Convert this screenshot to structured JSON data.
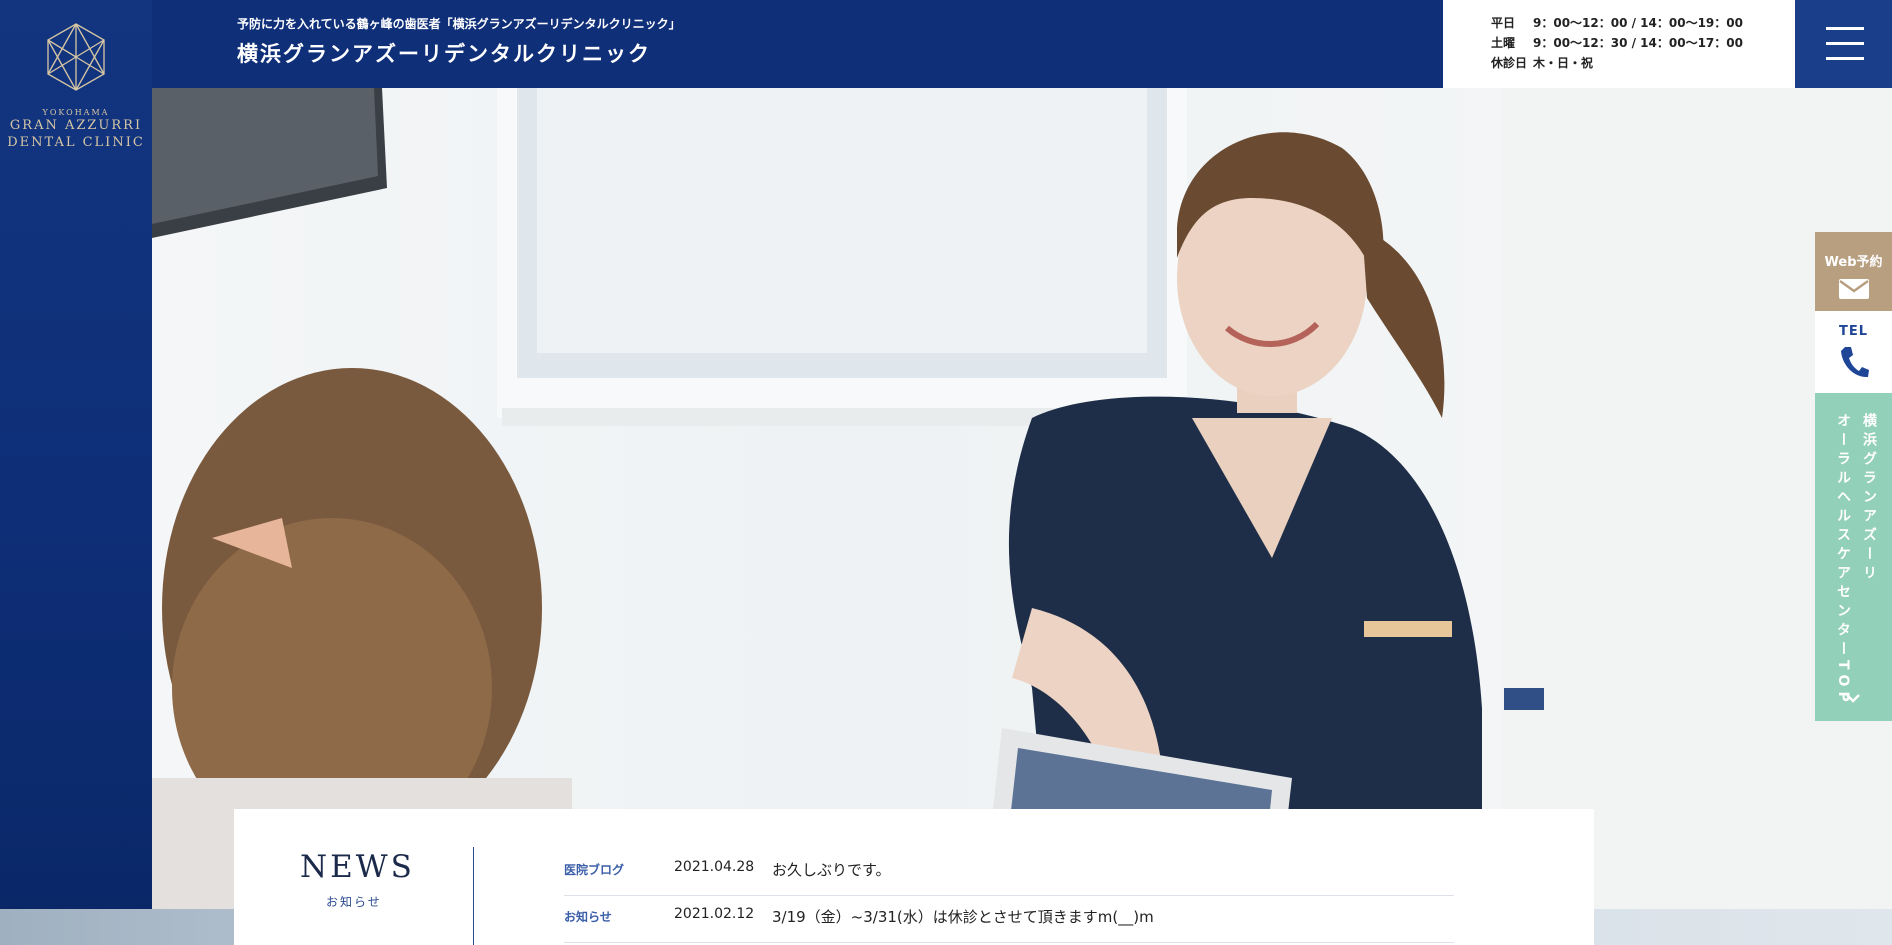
{
  "brand": {
    "logo_small": "YOKOHAMA",
    "logo_line1": "GRAN AZZURRI",
    "logo_line2": "DENTAL CLINIC"
  },
  "header": {
    "tagline": "予防に力を入れている鶴ヶ峰の歯医者「横浜グランアズーリデンタルクリニック」",
    "clinic_name": "横浜グランアズーリデンタルクリニック"
  },
  "hours": [
    {
      "day": "平日",
      "time": "9：00～12：00 / 14：00～19：00"
    },
    {
      "day": "土曜",
      "time": "9：00～12：30 / 14：00～17：00"
    },
    {
      "day": "休診日",
      "time": "木・日・祝"
    }
  ],
  "side": {
    "web_label": "Web予約",
    "tel_label": "TEL",
    "oral_line1": "横浜グランアズーリ",
    "oral_line2": "オーラルヘルスケアセンターTOP"
  },
  "news": {
    "title": "NEWS",
    "subtitle": "お知らせ",
    "items": [
      {
        "category": "医院ブログ",
        "date": "2021.04.28",
        "text": "お久しぶりです。"
      },
      {
        "category": "お知らせ",
        "date": "2021.02.12",
        "text": "3/19（金）~3/31(水）は休診とさせて頂きますm(__)m"
      }
    ]
  },
  "colors": {
    "navy": "#0f2f79",
    "gold": "#b79f80",
    "mint": "#93d0b9",
    "scrub": "#1f2e48"
  },
  "icons": [
    "menu-icon",
    "envelope-icon",
    "phone-icon",
    "chevron-down-icon"
  ]
}
